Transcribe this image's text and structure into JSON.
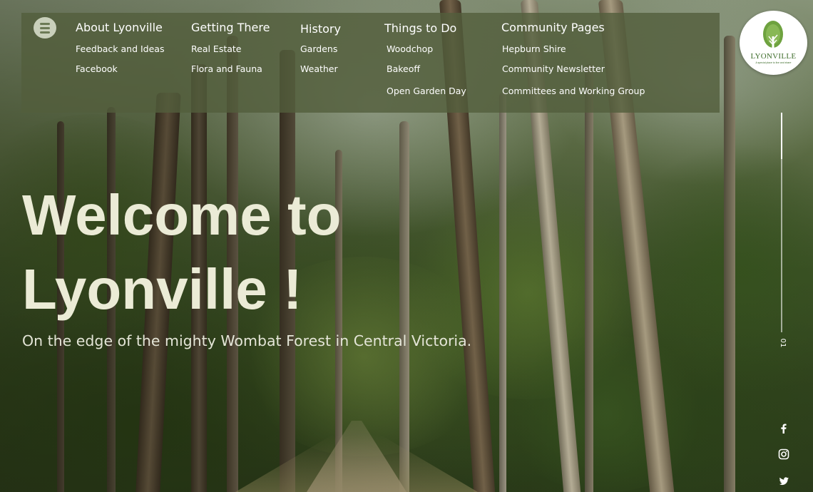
{
  "nav": {
    "menu_icon": "menu-icon",
    "columns": [
      {
        "heading": "About Lyonville",
        "links": [
          "Feedback and Ideas",
          "Facebook"
        ]
      },
      {
        "heading": "Getting There",
        "links": [
          "Real Estate",
          "Flora and Fauna"
        ]
      },
      {
        "heading": "History",
        "links": [
          "Gardens",
          "Weather"
        ]
      },
      {
        "heading": "Things to Do",
        "links": [
          "Woodchop",
          "Bakeoff",
          "Open Garden Day"
        ]
      },
      {
        "heading": "Community Pages",
        "links": [
          "Hepburn Shire",
          "Community Newsletter",
          "Committees and Working Group"
        ]
      }
    ]
  },
  "logo": {
    "name": "LYONVILLE",
    "tagline": "A special place to live and share"
  },
  "hero": {
    "title_line1": "Welcome to",
    "title_line2": "Lyonville !",
    "subtitle": "On the edge of the mighty Wombat Forest in Central Victoria."
  },
  "slider": {
    "current": "01",
    "progress": 0.21
  },
  "social": [
    "facebook-icon",
    "instagram-icon",
    "twitter-icon"
  ],
  "colors": {
    "nav_bg": "#525e3c",
    "hero_text": "#ebebd6",
    "logo_green": "#3e6d2b"
  }
}
